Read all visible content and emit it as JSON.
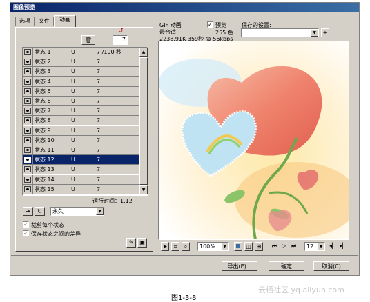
{
  "window": {
    "title": "图像预览"
  },
  "tabs": [
    {
      "label": "选项"
    },
    {
      "label": "文件"
    },
    {
      "label": "动画"
    }
  ],
  "animation": {
    "frame_number": "7",
    "columns": [],
    "frames": [
      {
        "name": "状态 1",
        "disposal": "U",
        "delay": "7 /100 秒"
      },
      {
        "name": "状态 2",
        "disposal": "U",
        "delay": "7"
      },
      {
        "name": "状态 3",
        "disposal": "U",
        "delay": "7"
      },
      {
        "name": "状态 4",
        "disposal": "U",
        "delay": "7"
      },
      {
        "name": "状态 5",
        "disposal": "U",
        "delay": "7"
      },
      {
        "name": "状态 6",
        "disposal": "U",
        "delay": "7"
      },
      {
        "name": "状态 7",
        "disposal": "U",
        "delay": "7"
      },
      {
        "name": "状态 8",
        "disposal": "U",
        "delay": "7"
      },
      {
        "name": "状态 9",
        "disposal": "U",
        "delay": "7"
      },
      {
        "name": "状态 10",
        "disposal": "U",
        "delay": "7"
      },
      {
        "name": "状态 11",
        "disposal": "U",
        "delay": "7"
      },
      {
        "name": "状态 12",
        "disposal": "U",
        "delay": "7"
      },
      {
        "name": "状态 13",
        "disposal": "U",
        "delay": "7"
      },
      {
        "name": "状态 14",
        "disposal": "U",
        "delay": "7"
      },
      {
        "name": "状态 15",
        "disposal": "U",
        "delay": "7"
      }
    ],
    "selected_index": 11,
    "runtime": "运行时间：1.12",
    "loop_value": "永久",
    "crop_each_frame": "裁剪每个状态",
    "save_diff": "保存状态之间的差异"
  },
  "info": {
    "format": "GIF 动画",
    "palette": "最合适",
    "size_time": "2238.91K  359秒 @ 56kbps",
    "preview_label": "预览",
    "colors": "255 色",
    "saved_settings_label": "保存的设置:"
  },
  "toolbar": {
    "zoom": "100%",
    "frame": "12"
  },
  "buttons": {
    "export": "导出(E)...",
    "ok": "确定",
    "cancel": "取消(C)"
  },
  "caption": "图1-3-8",
  "watermark": "云栖社区 yq.aliyun.com",
  "colors": {
    "accent": "#0a246a",
    "face": "#d4d0c8"
  }
}
